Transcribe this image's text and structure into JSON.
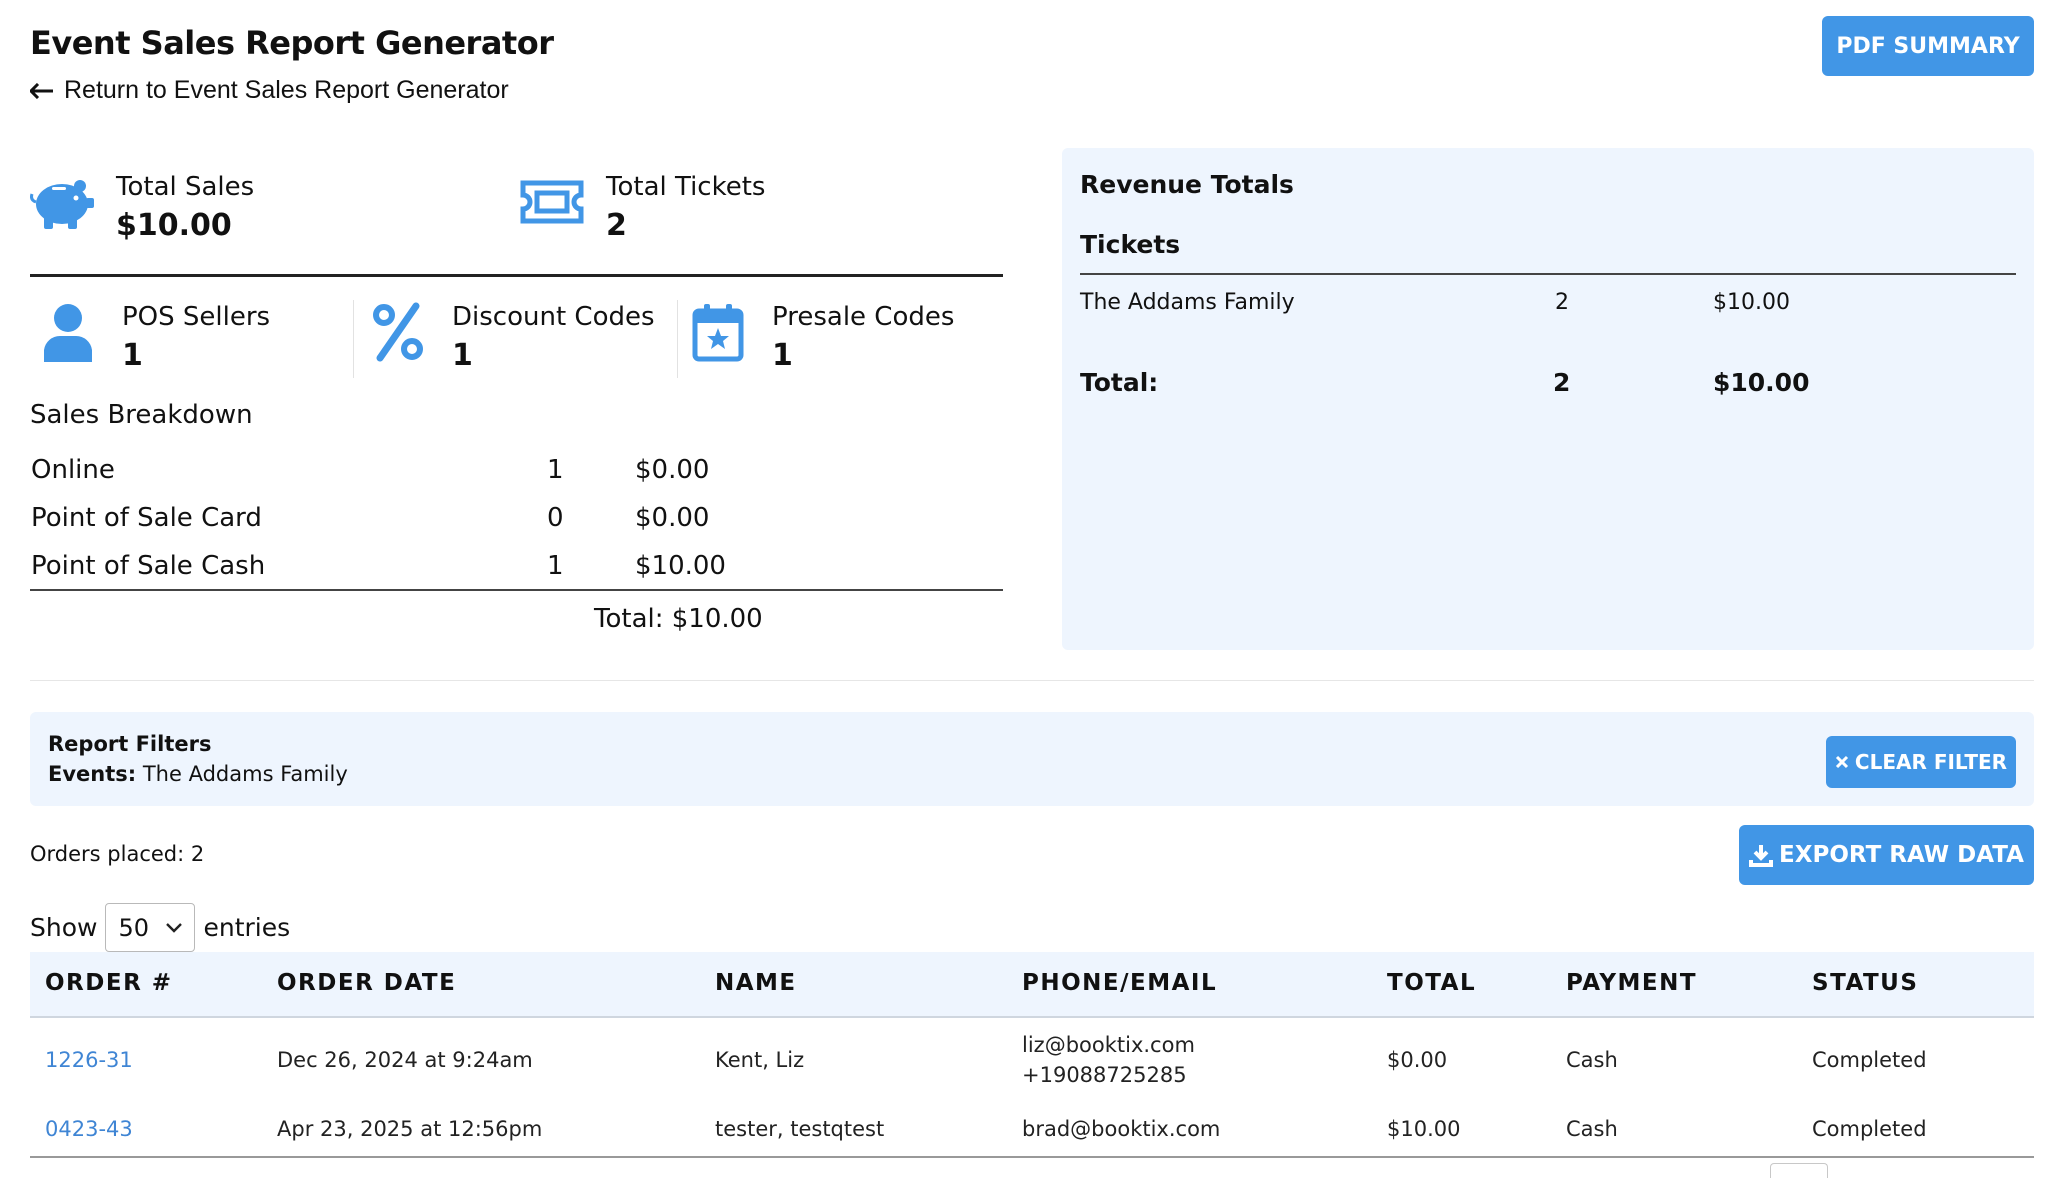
{
  "header": {
    "title": "Event Sales Report Generator",
    "back_link": "Return to Event Sales Report Generator",
    "pdf_button": "PDF SUMMARY"
  },
  "stats": {
    "total_sales": {
      "label": "Total Sales",
      "value": "$10.00",
      "icon": "piggy-bank-icon"
    },
    "total_tickets": {
      "label": "Total Tickets",
      "value": "2",
      "icon": "ticket-icon"
    },
    "pos_sellers": {
      "label": "POS Sellers",
      "value": "1",
      "icon": "user-icon"
    },
    "discount_codes": {
      "label": "Discount Codes",
      "value": "1",
      "icon": "percent-icon"
    },
    "presale_codes": {
      "label": "Presale Codes",
      "value": "1",
      "icon": "calendar-star-icon"
    }
  },
  "sales_breakdown": {
    "title": "Sales Breakdown",
    "rows": [
      {
        "name": "Online",
        "count": "1",
        "amount": "$0.00"
      },
      {
        "name": "Point of Sale Card",
        "count": "0",
        "amount": "$0.00"
      },
      {
        "name": "Point of Sale Cash",
        "count": "1",
        "amount": "$10.00"
      }
    ],
    "total": "Total: $10.00"
  },
  "revenue": {
    "title": "Revenue Totals",
    "subtitle": "Tickets",
    "rows": [
      {
        "name": "The Addams Family",
        "count": "2",
        "amount": "$10.00"
      }
    ],
    "total_label": "Total:",
    "total_count": "2",
    "total_amount": "$10.00"
  },
  "filters": {
    "title": "Report Filters",
    "events_label": "Events:",
    "events_value": "The Addams Family",
    "clear_button": "CLEAR FILTER"
  },
  "orders": {
    "placed": "Orders placed: 2",
    "export_button": "EXPORT RAW DATA",
    "show_label": "Show",
    "entries_value": "50",
    "entries_label": "entries",
    "columns": [
      "ORDER #",
      "ORDER DATE",
      "NAME",
      "PHONE/EMAIL",
      "TOTAL",
      "PAYMENT",
      "STATUS"
    ],
    "rows": [
      {
        "order": "1226-31",
        "date": "Dec 26, 2024 at 9:24am",
        "name": "Kent, Liz",
        "email": "liz@booktix.com",
        "phone": "+19088725285",
        "total": "$0.00",
        "payment": "Cash",
        "status": "Completed"
      },
      {
        "order": "0423-43",
        "date": "Apr 23, 2025 at 12:56pm",
        "name": "tester, testqtest",
        "email": "brad@booktix.com",
        "phone": "",
        "total": "$10.00",
        "payment": "Cash",
        "status": "Completed"
      }
    ]
  },
  "colors": {
    "accent": "#4196e6",
    "panel": "#eef5fe",
    "link": "#3f85d4"
  }
}
